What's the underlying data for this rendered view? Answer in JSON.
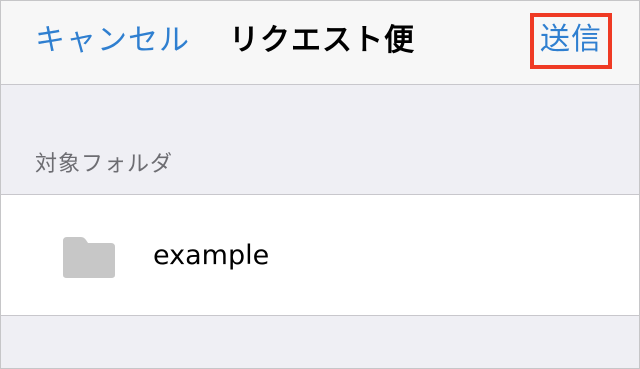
{
  "navbar": {
    "cancel_label": "キャンセル",
    "title": "リクエスト便",
    "send_label": "送信"
  },
  "section": {
    "header": "対象フォルダ"
  },
  "folder": {
    "icon": "folder-icon",
    "name": "example"
  },
  "colors": {
    "accent": "#2f7fd0",
    "highlight_border": "#ef3a24",
    "folder_icon": "#c7c7c7",
    "background": "#efeff4"
  }
}
